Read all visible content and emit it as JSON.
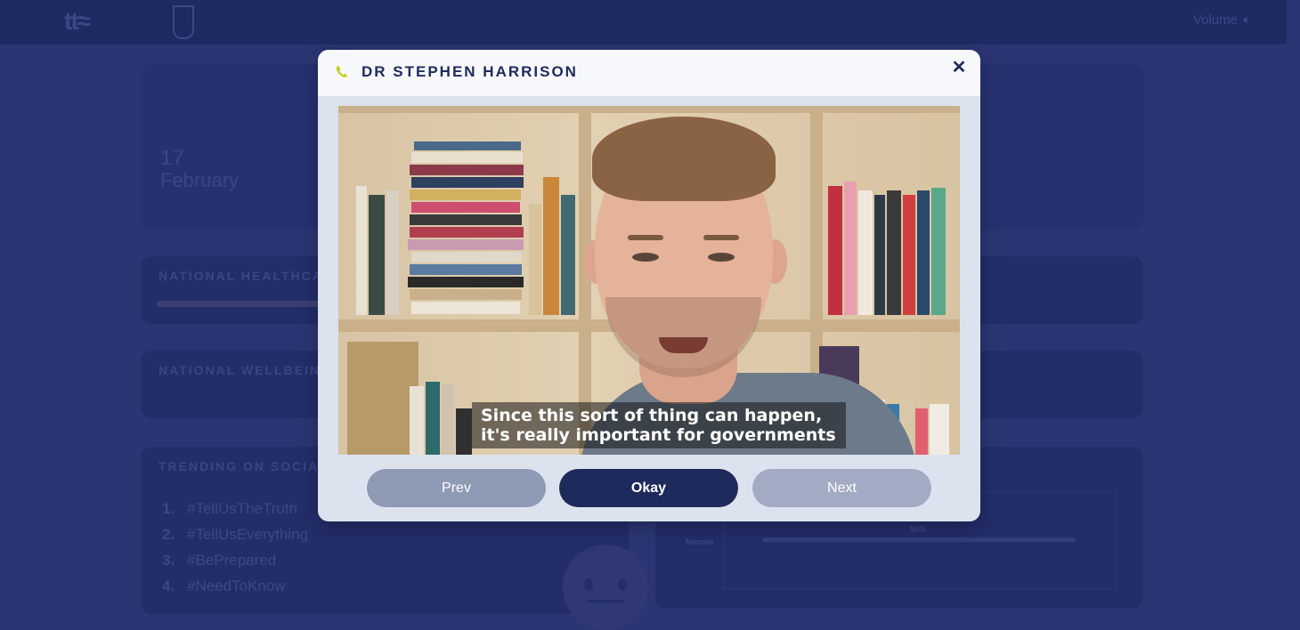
{
  "header": {
    "volume_label": "Volume",
    "volume_icon": "speaker-icon"
  },
  "background": {
    "date_day": "17",
    "date_month": "February",
    "panels": {
      "healthcare_title": "NATIONAL HEALTHCARE",
      "wellbeing_title": "NATIONAL WELLBEING",
      "social_title": "TRENDING ON SOCIAL"
    },
    "trending": [
      {
        "num": "1.",
        "tag": "#TellUsTheTruth"
      },
      {
        "num": "2.",
        "tag": "#TellUsEverything"
      },
      {
        "num": "3.",
        "tag": "#BePrepared"
      },
      {
        "num": "4.",
        "tag": "#NeedToKnow"
      }
    ],
    "chart_axis_label": "Normal",
    "chart_percent": "50%"
  },
  "modal": {
    "title": "DR STEPHEN HARRISON",
    "phone_icon": "phone-icon",
    "close_icon": "close-icon",
    "subtitle_line1": "Since this sort of thing can happen,",
    "subtitle_line2": "it's really important for governments",
    "buttons": {
      "prev": "Prev",
      "okay": "Okay",
      "next": "Next"
    }
  },
  "colors": {
    "page_bg": "#2b3573",
    "topbar_bg": "#1f2a63",
    "modal_bg": "#dde3ee",
    "primary_button": "#1f2a5c",
    "secondary_button": "#8f9ab5",
    "phone_accent": "#c4cf1e"
  }
}
